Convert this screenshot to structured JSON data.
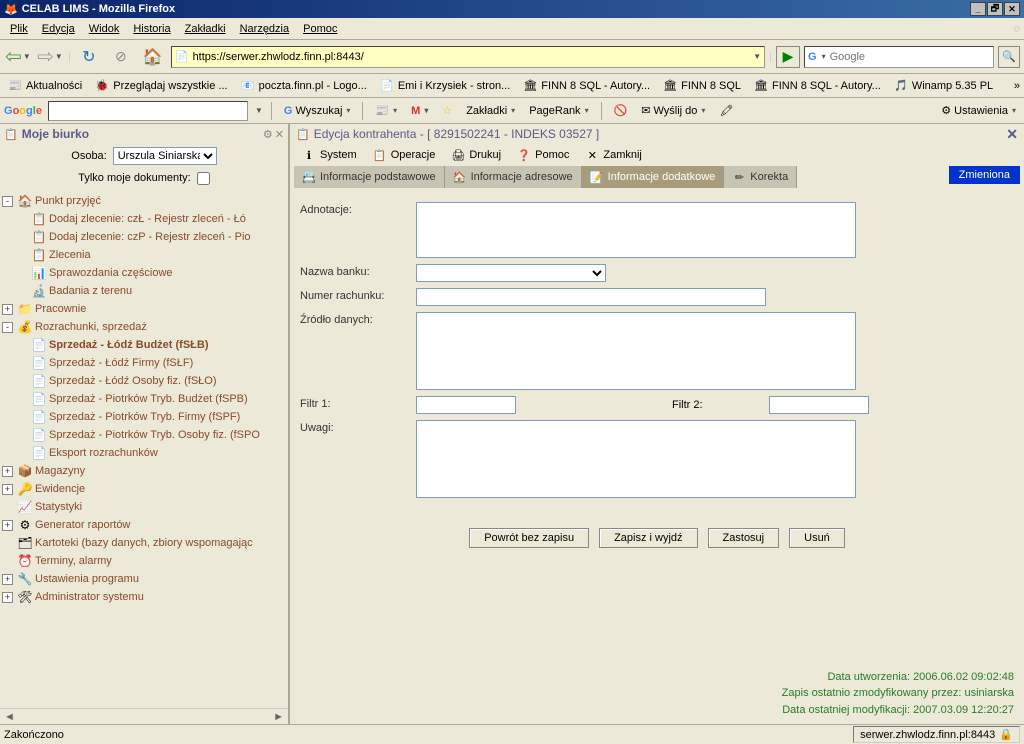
{
  "window": {
    "title": "CELAB LIMS - Mozilla Firefox"
  },
  "menubar": [
    "Plik",
    "Edycja",
    "Widok",
    "Historia",
    "Zakładki",
    "Narzędzia",
    "Pomoc"
  ],
  "url": "https://serwer.zhwlodz.finn.pl:8443/",
  "search_placeholder": "Google",
  "bookmarks": [
    {
      "icon": "📰",
      "label": "Aktualności"
    },
    {
      "icon": "🐞",
      "label": "Przeglądaj wszystkie ..."
    },
    {
      "icon": "📧",
      "label": "poczta.finn.pl - Logo..."
    },
    {
      "icon": "📄",
      "label": "Emi i Krzysiek - stron..."
    },
    {
      "icon": "🏛",
      "label": "FINN 8 SQL - Autory..."
    },
    {
      "icon": "🏛",
      "label": "FINN 8 SQL"
    },
    {
      "icon": "🏛",
      "label": "FINN 8 SQL - Autory..."
    },
    {
      "icon": "🎵",
      "label": "Winamp 5.35 PL"
    }
  ],
  "gtoolbar": {
    "wyszukaj": "Wyszukaj",
    "zakladki": "Zakładki",
    "pagerank": "PageRank",
    "wyslij": "Wyślij do",
    "ustawienia": "Ustawienia"
  },
  "sidebar": {
    "title": "Moje biurko",
    "osoba_label": "Osoba:",
    "osoba_value": "Urszula Siniarska",
    "tylko_moje": "Tylko moje dokumenty:"
  },
  "tree": [
    {
      "t": "-",
      "ind": 0,
      "icon": "🏠",
      "label": "Punkt przyjęć",
      "bold": false
    },
    {
      "t": "",
      "ind": 1,
      "icon": "📋",
      "label": "Dodaj zlecenie: czŁ - Rejestr zleceń - Łó"
    },
    {
      "t": "",
      "ind": 1,
      "icon": "📋",
      "label": "Dodaj zlecenie: czP - Rejestr zleceń - Pio"
    },
    {
      "t": "",
      "ind": 1,
      "icon": "📋",
      "label": "Zlecenia"
    },
    {
      "t": "",
      "ind": 1,
      "icon": "📊",
      "label": "Sprawozdania częściowe"
    },
    {
      "t": "",
      "ind": 1,
      "icon": "🔬",
      "label": "Badania z terenu"
    },
    {
      "t": "+",
      "ind": 0,
      "icon": "📁",
      "label": "Pracownie"
    },
    {
      "t": "-",
      "ind": 0,
      "icon": "💰",
      "label": "Rozrachunki, sprzedaż"
    },
    {
      "t": "",
      "ind": 1,
      "icon": "📄",
      "label": "Sprzedaż - Łódź Budżet (fSŁB)",
      "bold": true
    },
    {
      "t": "",
      "ind": 1,
      "icon": "📄",
      "label": "Sprzedaż - Łódź Firmy (fSŁF)"
    },
    {
      "t": "",
      "ind": 1,
      "icon": "📄",
      "label": "Sprzedaż - Łódź Osoby fiz. (fSŁO)"
    },
    {
      "t": "",
      "ind": 1,
      "icon": "📄",
      "label": "Sprzedaż - Piotrków Tryb. Budżet (fSPB)"
    },
    {
      "t": "",
      "ind": 1,
      "icon": "📄",
      "label": "Sprzedaż - Piotrków Tryb. Firmy (fSPF)"
    },
    {
      "t": "",
      "ind": 1,
      "icon": "📄",
      "label": "Sprzedaż - Piotrków Tryb. Osoby fiz. (fSPO"
    },
    {
      "t": "",
      "ind": 1,
      "icon": "📄",
      "label": "Eksport rozrachunków"
    },
    {
      "t": "+",
      "ind": 0,
      "icon": "📦",
      "label": "Magazyny"
    },
    {
      "t": "+",
      "ind": 0,
      "icon": "🔑",
      "label": "Ewidencje"
    },
    {
      "t": "",
      "ind": 0,
      "icon": "📈",
      "label": "Statystyki"
    },
    {
      "t": "+",
      "ind": 0,
      "icon": "⚙",
      "label": "Generator raportów"
    },
    {
      "t": "",
      "ind": 0,
      "icon": "🗂",
      "label": "Kartoteki (bazy danych, zbiory wspomagając"
    },
    {
      "t": "",
      "ind": 0,
      "icon": "⏰",
      "label": "Terminy, alarmy"
    },
    {
      "t": "+",
      "ind": 0,
      "icon": "🔧",
      "label": "Ustawienia programu"
    },
    {
      "t": "+",
      "ind": 0,
      "icon": "🛠",
      "label": "Administrator systemu"
    }
  ],
  "content": {
    "title": "Edycja kontrahenta - [ 8291502241 - INDEKS 03527 ]",
    "menu": [
      {
        "icon": "ℹ",
        "label": "System"
      },
      {
        "icon": "📋",
        "label": "Operacje"
      },
      {
        "icon": "🖨",
        "label": "Drukuj"
      },
      {
        "icon": "❓",
        "label": "Pomoc"
      },
      {
        "icon": "✕",
        "label": "Zamknij"
      }
    ],
    "tabs": [
      {
        "icon": "📇",
        "label": "Informacje podstawowe"
      },
      {
        "icon": "🏠",
        "label": "Informacje adresowe"
      },
      {
        "icon": "📝",
        "label": "Informacje dodatkowe"
      },
      {
        "icon": "✏",
        "label": "Korekta"
      }
    ],
    "zmieniona": "Zmieniona",
    "form": {
      "adnotacje": "Adnotacje:",
      "nazwa_banku": "Nazwa banku:",
      "numer": "Numer rachunku:",
      "zrodlo": "Źródło danych:",
      "filtr1": "Filtr 1:",
      "filtr2": "Filtr 2:",
      "uwagi": "Uwagi:"
    },
    "buttons": [
      "Powrót bez zapisu",
      "Zapisz i wyjdź",
      "Zastosuj",
      "Usuń"
    ],
    "meta": [
      "Data utworzenia: 2006.06.02 09:02:48",
      "Zapis ostatnio zmodyfikowany przez: usiniarska",
      "Data ostatniej modyfikacji: 2007.03.09 12:20:27"
    ]
  },
  "statusbar": {
    "left": "Zakończono",
    "right": "serwer.zhwlodz.finn.pl:8443"
  }
}
